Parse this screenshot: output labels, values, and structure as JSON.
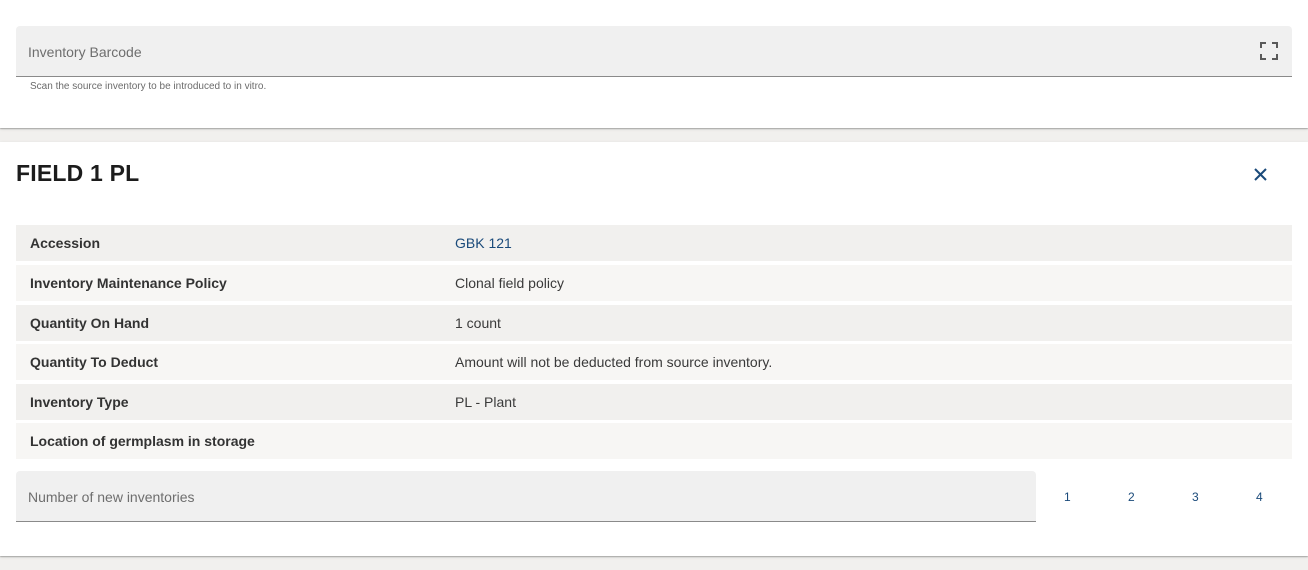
{
  "barcode_field": {
    "label": "Inventory Barcode",
    "hint": "Scan the source inventory to be introduced to in vitro.",
    "scan_icon": "fullscreen-scan-icon"
  },
  "inventory": {
    "title": "FIELD 1 PL",
    "close_icon": "close-icon",
    "details": [
      {
        "label": "Accession",
        "value": "GBK 121",
        "is_link": true
      },
      {
        "label": "Inventory Maintenance Policy",
        "value": "Clonal field policy"
      },
      {
        "label": "Quantity On Hand",
        "value": "1 count"
      },
      {
        "label": "Quantity To Deduct",
        "value": "Amount will not be deducted from source inventory."
      },
      {
        "label": "Inventory Type",
        "value": "PL - Plant"
      },
      {
        "label": "Location of germplasm in storage",
        "value": ""
      }
    ]
  },
  "new_inventories": {
    "label": "Number of new inventories",
    "options": [
      "1",
      "2",
      "3",
      "4"
    ]
  },
  "colors": {
    "accent": "#1a4a7a",
    "background": "#f1f0ee",
    "field_fill": "#f0f0f0"
  }
}
